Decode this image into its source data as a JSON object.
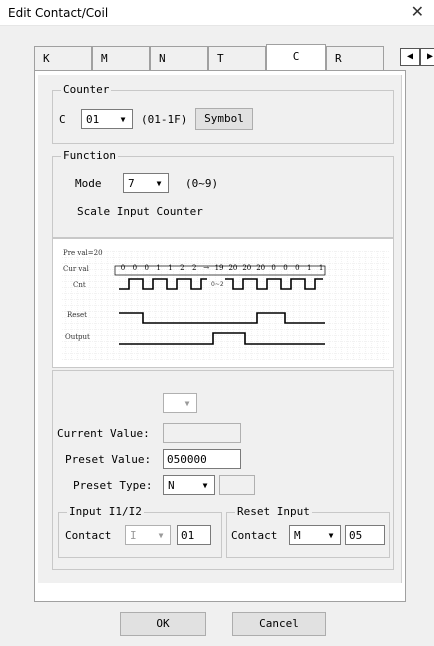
{
  "window": {
    "title": "Edit Contact/Coil",
    "close_glyph": "✕"
  },
  "tabs": [
    {
      "label": "K",
      "active": false
    },
    {
      "label": "M",
      "active": false
    },
    {
      "label": "N",
      "active": false
    },
    {
      "label": "T",
      "active": false
    },
    {
      "label": "C",
      "active": true
    },
    {
      "label": "R",
      "active": false
    }
  ],
  "tab_scroll": {
    "left": "◀",
    "right": "▶"
  },
  "counter": {
    "legend": "Counter",
    "prefix": "C",
    "selected": "01",
    "range": "(01-1F)",
    "symbol_button": "Symbol"
  },
  "function": {
    "legend": "Function",
    "mode_label": "Mode",
    "mode_value": "7",
    "mode_range": "(0~9)",
    "description": "Scale Input Counter"
  },
  "timing_diagram": {
    "preset_label": "Pre val=20",
    "current_label": "Cur val",
    "cnt_label": "Cnt",
    "reset_label": "Reset",
    "output_label": "Output",
    "current_values": [
      "0",
      "0",
      "0",
      "1",
      "1",
      "2",
      "2",
      "→",
      "19",
      "20",
      "20",
      "20",
      "0",
      "0",
      "0",
      "1",
      "1"
    ],
    "cnt_note": "0~2"
  },
  "values": {
    "current_label": "Current Value:",
    "current_value": "",
    "preset_label": "Preset Value:",
    "preset_value": "050000",
    "preset_type_label": "Preset Type:",
    "preset_type_value": "N",
    "preset_type_extra": ""
  },
  "input_group": {
    "legend": "Input I1/I2",
    "contact_label": "Contact",
    "contact_type": "I",
    "contact_number": "01"
  },
  "reset_group": {
    "legend": "Reset Input",
    "contact_label": "Contact",
    "contact_type": "M",
    "contact_number": "05"
  },
  "buttons": {
    "ok": "OK",
    "cancel": "Cancel"
  },
  "colors": {
    "dialog_bg": "#f0f0f0",
    "border": "#a0a0a0",
    "diagram_line": "#000000"
  }
}
